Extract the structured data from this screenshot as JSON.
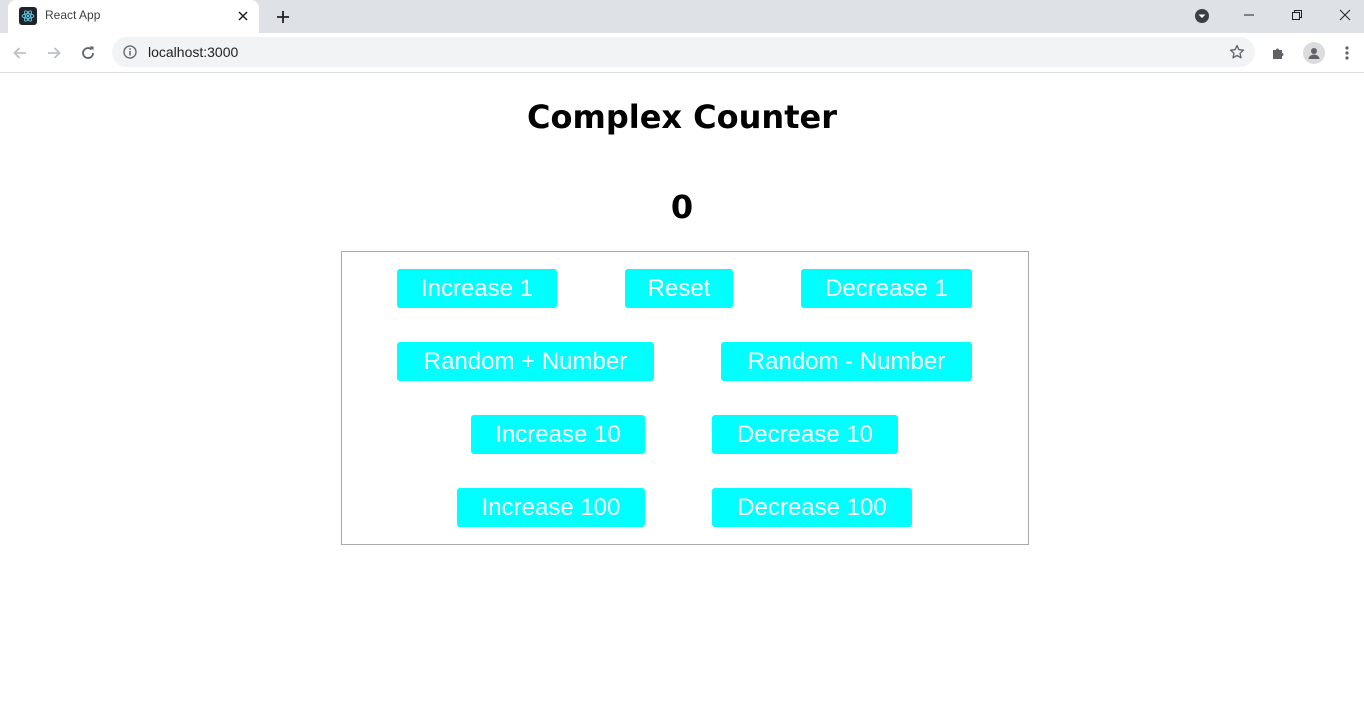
{
  "browser": {
    "tab_title": "React App",
    "url": "localhost:3000"
  },
  "page": {
    "title": "Complex Counter",
    "counter_value": "0"
  },
  "buttons": {
    "increase_1": "Increase 1",
    "reset": "Reset",
    "decrease_1": "Decrease 1",
    "random_plus": "Random + Number",
    "random_minus": "Random - Number",
    "increase_10": "Increase 10",
    "decrease_10": "Decrease 10",
    "increase_100": "Increase 100",
    "decrease_100": "Decrease 100"
  },
  "colors": {
    "button_bg": "#00ffff",
    "button_text": "#ffffff",
    "panel_border": "#a9a9a9",
    "tabstrip_bg": "#dee1e6"
  },
  "icons": {
    "favicon": "react-logo-icon",
    "tab_close": "close-icon",
    "new_tab": "plus-icon",
    "back": "arrow-left-icon",
    "forward": "arrow-right-icon",
    "reload": "reload-icon",
    "site_info": "info-icon",
    "bookmark": "star-icon",
    "extensions": "puzzle-icon",
    "profile": "person-icon",
    "menu": "kebab-menu-icon"
  }
}
